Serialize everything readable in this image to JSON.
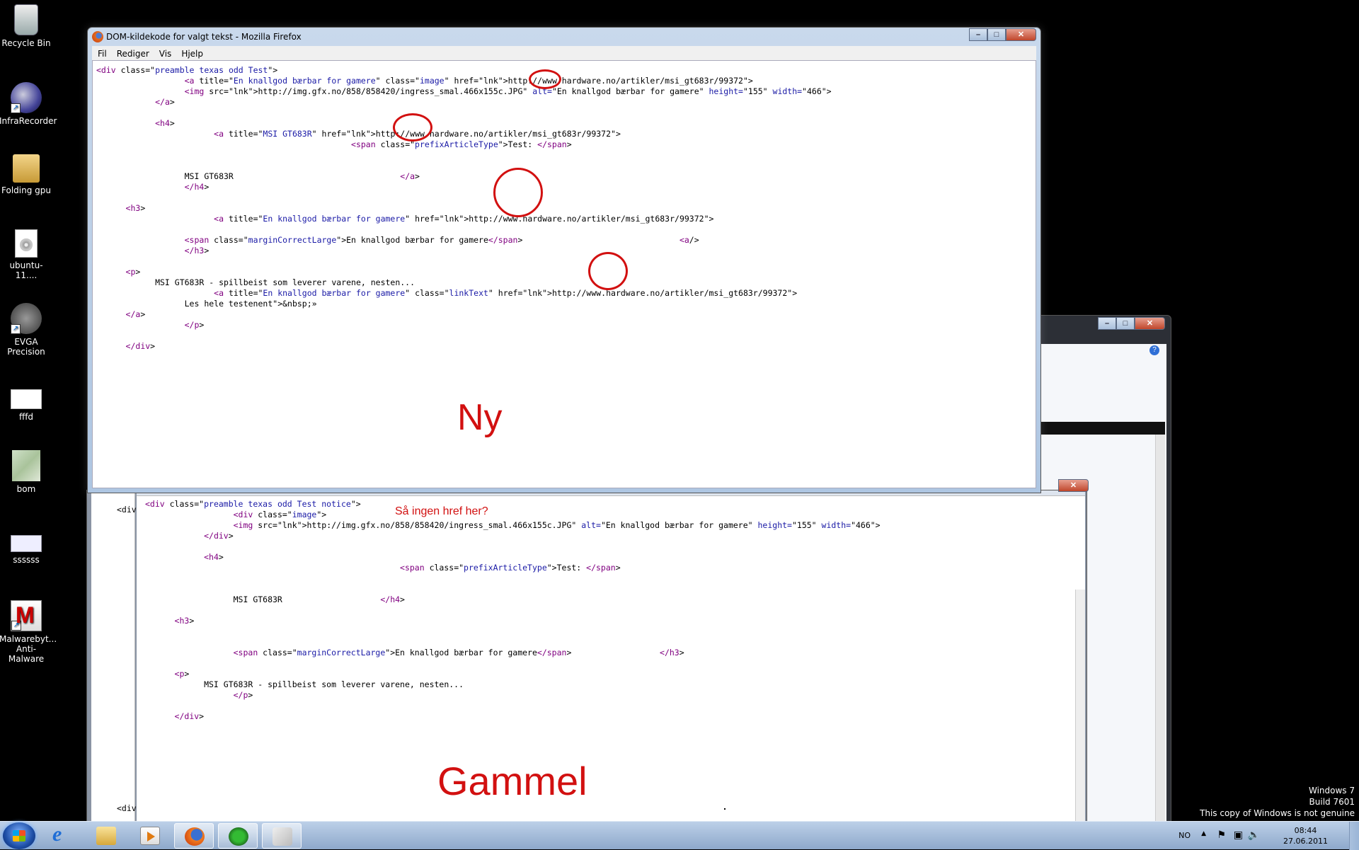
{
  "desktop_icons": [
    {
      "label": "Recycle Bin",
      "icon": "recycle-bin-icon"
    },
    {
      "label": "InfraRecorder",
      "icon": "infrarecorder-icon"
    },
    {
      "label": "Folding gpu",
      "icon": "folder-icon"
    },
    {
      "label": "ubuntu-11....",
      "icon": "disc-image-icon"
    },
    {
      "label": "EVGA Precision",
      "icon": "evga-precision-icon"
    },
    {
      "label": "fffd",
      "icon": "image-file-icon"
    },
    {
      "label": "bom",
      "icon": "map-image-icon"
    },
    {
      "label": "ssssss",
      "icon": "image-file-icon"
    },
    {
      "label": "Malwarebyt... Anti-Malware",
      "icon": "malwarebytes-icon"
    }
  ],
  "firefox_window": {
    "title": "DOM-kildekode for valgt tekst - Mozilla Firefox",
    "menu": [
      "Fil",
      "Rediger",
      "Vis",
      "Hjelp"
    ],
    "code_lines": [
      "<div class=\"preamble texas odd Test\">",
      "                  <a title=\"En knallgod bærbar for gamere\" class=\"image\" href=\"http://www.hardware.no/artikler/msi_gt683r/99372\">",
      "                  <img src=\"http://img.gfx.no/858/858420/ingress_smal.466x155c.JPG\" alt=\"En knallgod bærbar for gamere\" height=\"155\" width=\"466\">",
      "            </a>",
      "",
      "            <h4>",
      "                        <a title=\"MSI GT683R\" href=\"http://www.hardware.no/artikler/msi_gt683r/99372\">",
      "                                                    <span class=\"prefixArticleType\">Test: </span>",
      "",
      "",
      "                  MSI GT683R                                  </a>",
      "                  </h4>",
      "",
      "      <h3>",
      "                        <a title=\"En knallgod bærbar for gamere\" href=\"http://www.hardware.no/artikler/msi_gt683r/99372\">",
      "",
      "                  <span class=\"marginCorrectLarge\">En knallgod bærbar for gamere</span>                                <a/>",
      "                  </h3>",
      "",
      "      <p>",
      "            MSI GT683R - spillbeist som leverer varene, nesten...",
      "                        <a title=\"En knallgod bærbar for gamere\" class=\"linkText\" href=\"http://www.hardware.no/artikler/msi_gt683r/99372\">",
      "                  Les hele testen&nbsp;»",
      "      </a>",
      "                  </p>",
      "",
      "      </div>"
    ],
    "annotation": "Ny"
  },
  "old_window": {
    "code_lines": [
      "<div class=\"preamble texas odd Test notice\">",
      "                  <div class=\"image\">",
      "                  <img src=\"http://img.gfx.no/858/858420/ingress_smal.466x155c.JPG\" alt=\"En knallgod bærbar for gamere\" height=\"155\" width=\"466\">",
      "            </div>",
      "",
      "            <h4>",
      "                                                    <span class=\"prefixArticleType\">Test: </span>",
      "",
      "",
      "                  MSI GT683R                    </h4>",
      "",
      "      <h3>",
      "",
      "",
      "                  <span class=\"marginCorrectLarge\">En knallgod bærbar for gamere</span>                  </h3>",
      "",
      "      <p>",
      "            MSI GT683R - spillbeist som leverer varene, nesten...",
      "                  </p>",
      "",
      "      </div>"
    ],
    "left_tab_top": "<div",
    "left_tab_bottom": "<div",
    "question": "Så ingen href her?",
    "annotation": "Gammel"
  },
  "taskbar": {
    "pinned": [
      "internet-explorer-icon",
      "windows-explorer-icon",
      "media-player-icon",
      "firefox-icon",
      "spotify-icon",
      "paint-icon"
    ],
    "language": "NO",
    "time": "08:44",
    "date": "27.06.2011"
  },
  "watermark": {
    "line1": "Windows 7",
    "line2": "Build 7601",
    "line3": "This copy of Windows is not genuine"
  },
  "colors": {
    "annotation": "#d21010",
    "code_tag": "#800080",
    "code_value": "#1a1aa6"
  }
}
